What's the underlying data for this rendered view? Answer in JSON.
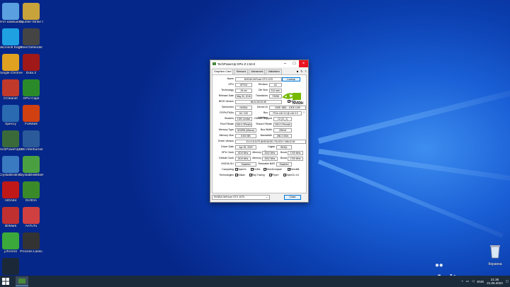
{
  "desktop_icons": [
    {
      "label": "Этот компьютер",
      "color": "#5aa0e0",
      "icon": "computer-icon"
    },
    {
      "label": "Counter-Strike Global Offensive",
      "color": "#c8a23a",
      "icon": "cs-icon"
    },
    {
      "label": "Microsoft Edge",
      "color": "#1fa0e0",
      "icon": "edge-icon"
    },
    {
      "label": "Steel Defender",
      "color": "#444",
      "icon": "game-icon"
    },
    {
      "label": "Google Chrome",
      "color": "#e0a020",
      "icon": "chrome-icon"
    },
    {
      "label": "Dota 2",
      "color": "#a01818",
      "icon": "dota-icon"
    },
    {
      "label": "CCleaner",
      "color": "#c0392b",
      "icon": "ccleaner-icon"
    },
    {
      "label": "GPU Caps",
      "color": "#2a8a2a",
      "icon": "gpucaps-icon"
    },
    {
      "label": "Speccy",
      "color": "#2a6ab0",
      "icon": "speccy-icon"
    },
    {
      "label": "FurMark",
      "color": "#d04010",
      "icon": "furmark-icon"
    },
    {
      "label": "TechPowerUp GPU-Z",
      "color": "#3a6a3a",
      "icon": "gpuz-icon"
    },
    {
      "label": "MSI Afterburner",
      "color": "#2a5a9a",
      "icon": "afterburner-icon"
    },
    {
      "label": "CrystalDiskInfo",
      "color": "#3a7ac0",
      "icon": "diskinfo-icon"
    },
    {
      "label": "CrystalDiskMark",
      "color": "#4aa040",
      "icon": "diskmark-icon"
    },
    {
      "label": "AIDA64",
      "color": "#c01818",
      "icon": "aida-icon"
    },
    {
      "label": "NVIDIA",
      "color": "#3a8a2a",
      "icon": "nvidia-icon"
    },
    {
      "label": "3DMark",
      "color": "#c03030",
      "icon": "3dmark-icon"
    },
    {
      "label": "AnTuTu",
      "color": "#d04040",
      "icon": "antutu-icon"
    },
    {
      "label": "µTorrent",
      "color": "#3aa83a",
      "icon": "utorrent-icon"
    },
    {
      "label": "Process Lasso",
      "color": "#333",
      "icon": "lasso-icon"
    },
    {
      "label": "Steam",
      "color": "#1b2838",
      "icon": "steam-icon"
    }
  ],
  "recycle_bin": {
    "label": "Корзина"
  },
  "window": {
    "title": "TechPowerUp GPU-Z 2.53.0",
    "tabs": [
      "Graphics Card",
      "Sensors",
      "Advanced",
      "Validation"
    ],
    "lookup": "Lookup",
    "close": "Close",
    "gpu_select": "NVIDIA GeForce GTX 1070",
    "fields": {
      "name": {
        "label": "Name",
        "value": "NVIDIA GeForce GTX 1070"
      },
      "gpu": {
        "label": "GPU",
        "value": "GP104"
      },
      "revision": {
        "label": "Revision",
        "value": "A1"
      },
      "technology": {
        "label": "Technology",
        "value": "16 nm"
      },
      "die_size": {
        "label": "Die Size",
        "value": "314 mm²"
      },
      "release_date": {
        "label": "Release Date",
        "value": "May 30, 2016"
      },
      "transistors": {
        "label": "Transistors",
        "value": "7200M"
      },
      "bios": {
        "label": "BIOS Version",
        "value": "86.04.50.00.5E"
      },
      "uefi": "UEFI",
      "subvendor": {
        "label": "Subvendor",
        "value": "NVIDIA"
      },
      "device_id": {
        "label": "Device ID",
        "value": "10DE 1B81 - 10DE 1190"
      },
      "rops": {
        "label": "ROPs/TMUs",
        "value": "64 / 120"
      },
      "bus_interface": {
        "label": "Bus Interface",
        "value": "PCIe x16 3.0 @ x16 3.0"
      },
      "shaders": {
        "label": "Shaders",
        "value": "1920 Unified"
      },
      "directx": {
        "label": "DirectX Support",
        "value": "12 (12_1)"
      },
      "pixel_fillrate": {
        "label": "Pixel Fillrate",
        "value": "108.4 GPixel/s"
      },
      "texture_fillrate": {
        "label": "Texture Fillrate",
        "value": "203.3 GTexel/s"
      },
      "memory_type": {
        "label": "Memory Type",
        "value": "GDDR5 (Micron)"
      },
      "bus_width": {
        "label": "Bus Width",
        "value": "256 bit"
      },
      "memory_size": {
        "label": "Memory Size",
        "value": "8192 MB"
      },
      "bandwidth": {
        "label": "Bandwidth",
        "value": "256.3 GB/s"
      },
      "driver_version": {
        "label": "Driver Version",
        "value": "31.0.15.3179 (NVIDIA 531.79) DCH / Win10 64"
      },
      "driver_date": {
        "label": "Driver Date",
        "value": "Apr 25, 2023"
      },
      "digital_signature": {
        "label": "Digital Signature",
        "value": "WHQL"
      },
      "gpu_clock": {
        "label": "GPU Clock",
        "value": "1519 MHz"
      },
      "memory_clock": {
        "label": "Memory",
        "value": "2002 MHz"
      },
      "boost_clock": {
        "label": "Boost",
        "value": "1709 MHz"
      },
      "default_clock": {
        "label": "Default Clock",
        "value": "1519 MHz"
      },
      "default_memory": {
        "label": "Memory",
        "value": "2002 MHz"
      },
      "default_boost": {
        "label": "Boost",
        "value": "1709 MHz"
      },
      "sli": {
        "label": "NVIDIA SLI",
        "value": "Disabled"
      },
      "resizable_bar": {
        "label": "Resizable BAR",
        "value": "Disabled"
      },
      "computing": {
        "label": "Computing",
        "items": [
          "OpenCL",
          "CUDA",
          "DirectCompute",
          "DirectML"
        ]
      },
      "technologies": {
        "label": "Technologies",
        "items": [
          "Vulkan",
          "Ray Tracing",
          "PhysX",
          "OpenGL 4.6"
        ]
      }
    }
  },
  "taskbar": {
    "lang": "ENG",
    "time": "21:36",
    "date": "21.05.2023"
  },
  "watermark": "Avito"
}
